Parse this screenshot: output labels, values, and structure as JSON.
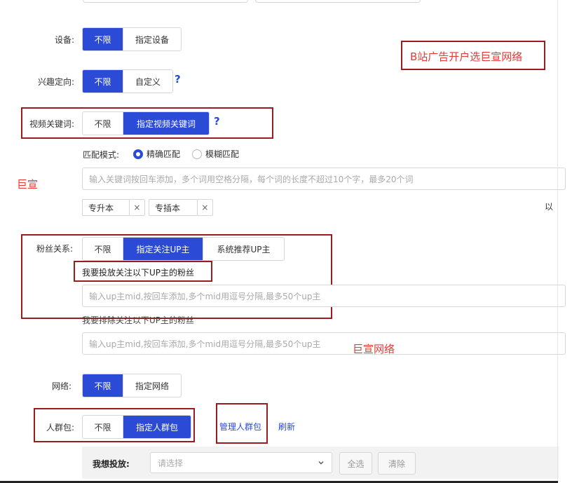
{
  "annotations": {
    "bili_title": "B站广告开户选巨宣网络",
    "left_note": "巨宣",
    "mid_note": "巨宣网络"
  },
  "device": {
    "label": "设备:",
    "options": [
      "不限",
      "指定设备"
    ],
    "selected": 0
  },
  "interest": {
    "label": "兴趣定向:",
    "options": [
      "不限",
      "自定义"
    ],
    "selected": 0,
    "help": "?"
  },
  "video_keyword": {
    "label": "视频关键词:",
    "options": [
      "不限",
      "指定视频关键词"
    ],
    "selected": 1,
    "help": "?",
    "match_mode_label": "匹配模式:",
    "match_options": [
      "精确匹配",
      "模糊匹配"
    ],
    "match_selected": 0,
    "input_placeholder": "输入关键词按回车添加，多个词用空格分隔，每个词的长度不超过10个字，最多20个词",
    "tags": [
      "专升本",
      "专插本"
    ],
    "tag_close": "×",
    "right_clip_text": "以"
  },
  "fans": {
    "label": "粉丝关系:",
    "options": [
      "不限",
      "指定关注UP主",
      "系统推荐UP主"
    ],
    "selected": 1,
    "include_label": "我要投放关注以下UP主的粉丝",
    "include_placeholder": "输入up主mid,按回车添加,多个mid用逗号分隔,最多50个up主",
    "exclude_label": "我要排除关注以下UP主的粉丝",
    "exclude_placeholder": "输入up主mid,按回车添加,多个mid用逗号分隔,最多50个up主"
  },
  "network": {
    "label": "网络:",
    "options": [
      "不限",
      "指定网络"
    ],
    "selected": 0
  },
  "crowd": {
    "label": "人群包:",
    "options": [
      "不限",
      "指定人群包"
    ],
    "selected": 1,
    "manage_link": "管理人群包",
    "refresh_link": "刷新"
  },
  "delivery": {
    "label": "我想投放:",
    "select_placeholder": "请选择",
    "select_all": "全选",
    "clear": "清除"
  }
}
